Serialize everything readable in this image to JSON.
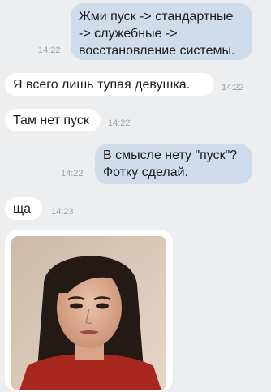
{
  "messages": [
    {
      "side": "out",
      "lines": [
        "Жми пуск -> стандартные",
        "-> служебные ->",
        "восстановление системы."
      ],
      "time": "14:22"
    },
    {
      "side": "in",
      "lines": [
        "Я всего лишь тупая девушка."
      ],
      "time": "14:22"
    },
    {
      "side": "in",
      "lines": [
        "Там нет пуск"
      ],
      "time": "14:22"
    },
    {
      "side": "out",
      "lines": [
        "В смысле нету \"пуск\"?",
        "Фотку сделай."
      ],
      "time": "14:22"
    },
    {
      "side": "in",
      "lines": [
        "ща"
      ],
      "time": "14:23"
    }
  ],
  "photo": {
    "description_icon": "selfie-photo"
  },
  "colors": {
    "background": "#edeef0",
    "outgoing": "#cfdcec",
    "incoming": "#ffffff",
    "time": "#9aa3ad"
  }
}
